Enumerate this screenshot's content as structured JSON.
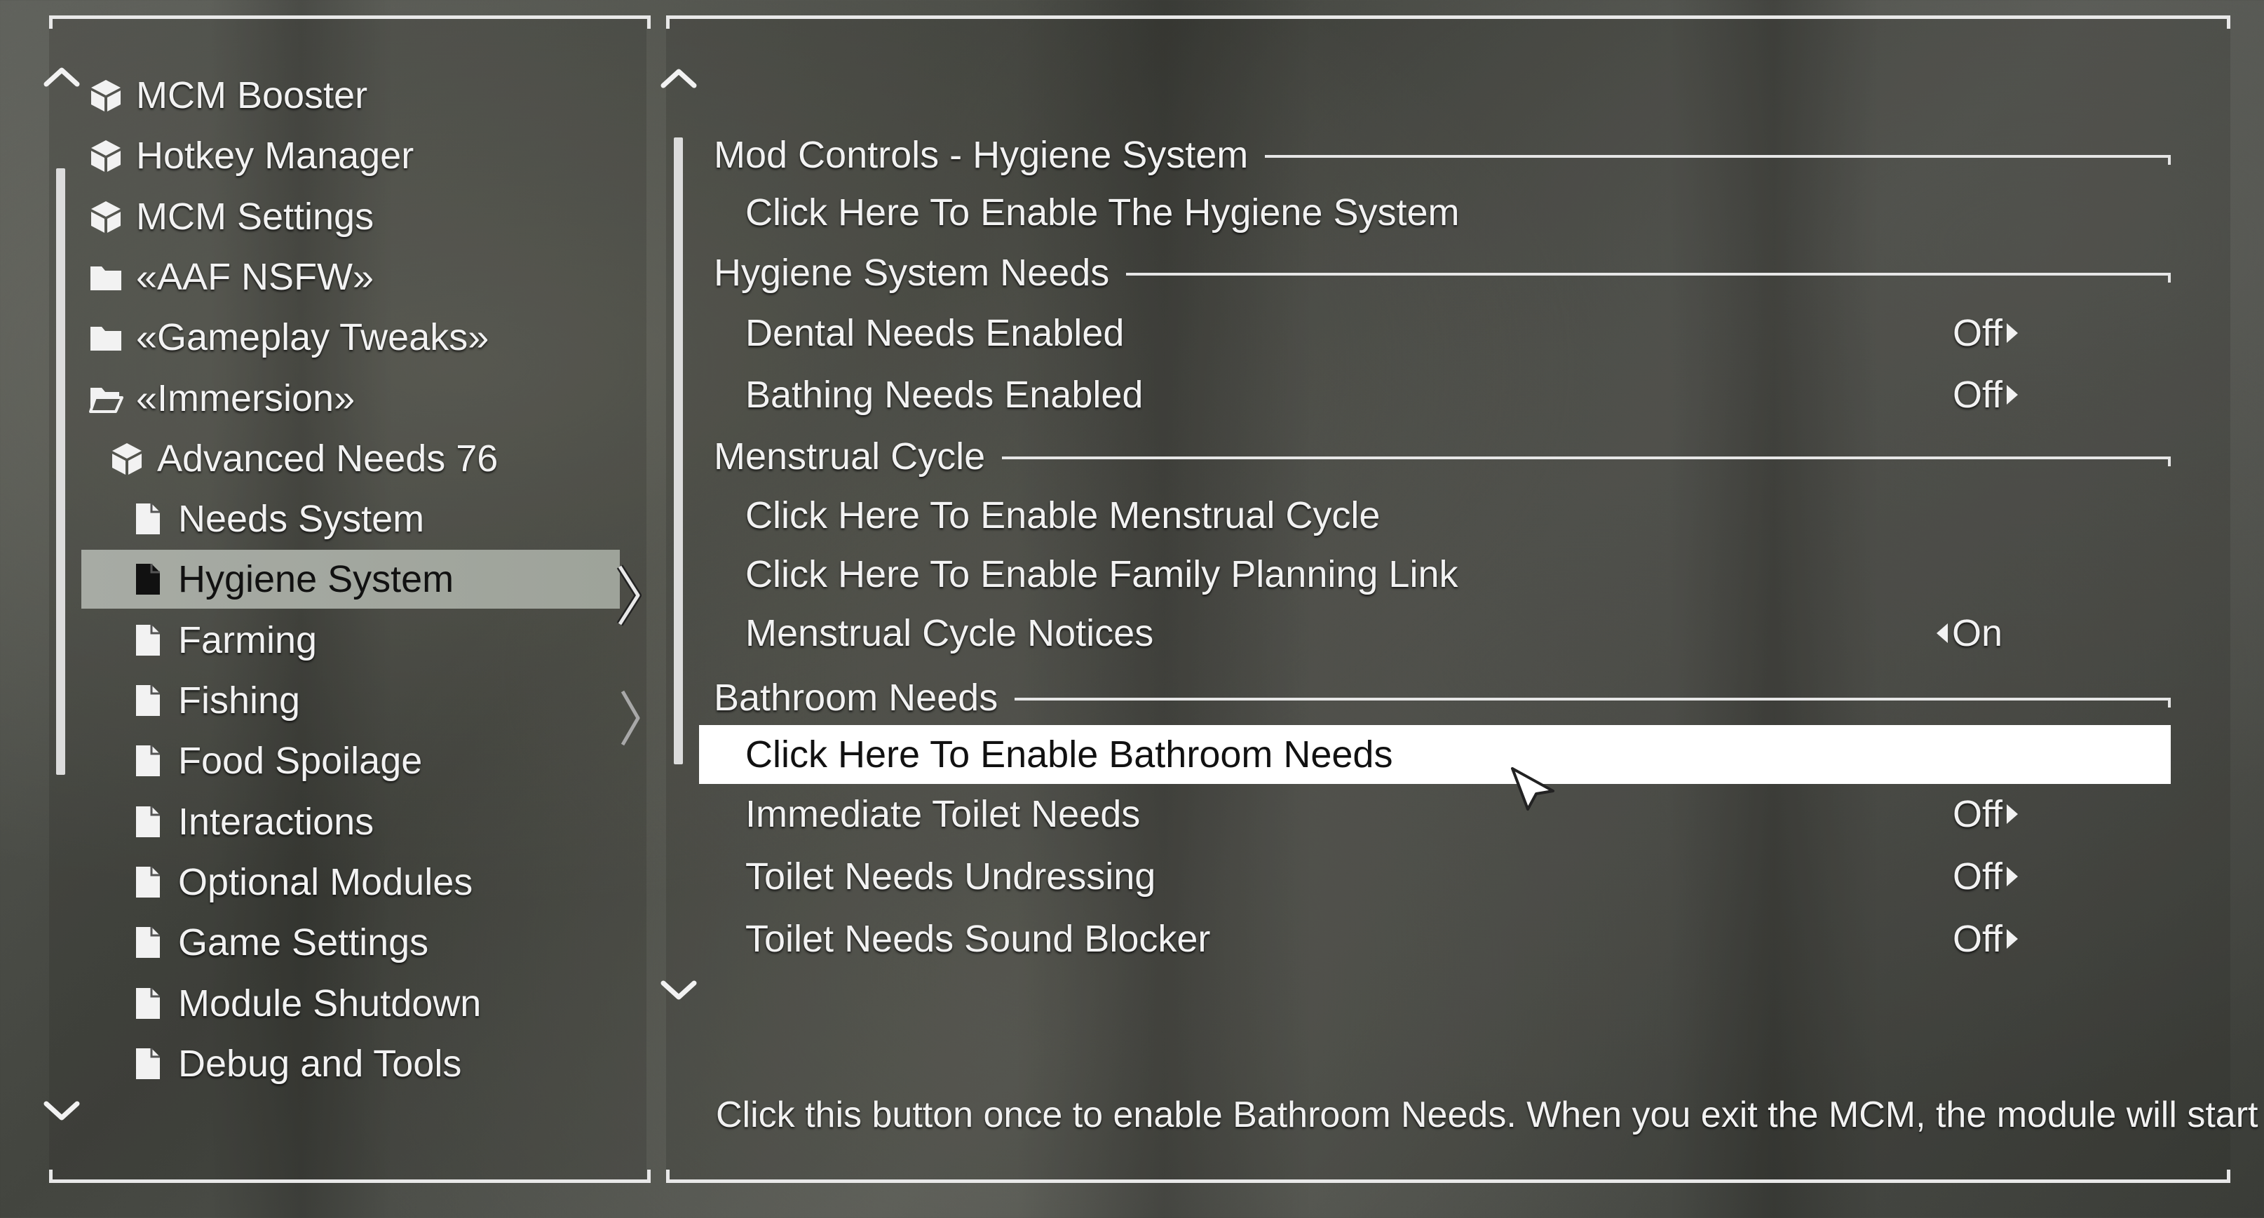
{
  "colors": {
    "frame": "#e8e8e8",
    "selected_bg": "#a7aba4",
    "highlight_bg": "#ffffff",
    "text": "#f2f2f2"
  },
  "left_nav": {
    "scroll_up_icon": "chevron-up-icon",
    "scroll_down_icon": "chevron-down-icon",
    "items": [
      {
        "label": "MCM Booster",
        "icon": "cube-icon",
        "level": 0
      },
      {
        "label": "Hotkey Manager",
        "icon": "cube-icon",
        "level": 0
      },
      {
        "label": "MCM Settings",
        "icon": "cube-icon",
        "level": 0
      },
      {
        "label": "«AAF NSFW»",
        "icon": "folder-icon",
        "level": 0
      },
      {
        "label": "«Gameplay Tweaks»",
        "icon": "folder-icon",
        "level": 0
      },
      {
        "label": "«Immersion»",
        "icon": "folder-open-icon",
        "level": 0
      },
      {
        "label": "Advanced Needs 76",
        "icon": "cube-icon",
        "level": 1
      },
      {
        "label": "Needs System",
        "icon": "page-icon",
        "level": 2
      },
      {
        "label": "Hygiene System",
        "icon": "page-icon",
        "level": 2,
        "selected": true
      },
      {
        "label": "Farming",
        "icon": "page-icon",
        "level": 2
      },
      {
        "label": "Fishing",
        "icon": "page-icon",
        "level": 2
      },
      {
        "label": "Food Spoilage",
        "icon": "page-icon",
        "level": 2
      },
      {
        "label": "Interactions",
        "icon": "page-icon",
        "level": 2
      },
      {
        "label": "Optional Modules",
        "icon": "page-icon",
        "level": 2
      },
      {
        "label": "Game Settings",
        "icon": "page-icon",
        "level": 2
      },
      {
        "label": "Module Shutdown",
        "icon": "page-icon",
        "level": 2
      },
      {
        "label": "Debug and Tools",
        "icon": "page-icon",
        "level": 2
      }
    ]
  },
  "settings": {
    "sections": [
      {
        "title": "Mod Controls - Hygiene System",
        "options": [
          {
            "label": "Click Here To Enable The Hygiene System",
            "value": "",
            "type": "button"
          }
        ]
      },
      {
        "title": "Hygiene System Needs",
        "options": [
          {
            "label": "Dental Needs Enabled",
            "value": "Off",
            "type": "toggle"
          },
          {
            "label": "Bathing Needs Enabled",
            "value": "Off",
            "type": "toggle"
          }
        ]
      },
      {
        "title": "Menstrual Cycle",
        "options": [
          {
            "label": "Click Here To Enable Menstrual Cycle",
            "value": "",
            "type": "button"
          },
          {
            "label": "Click Here To Enable Family Planning Link",
            "value": "",
            "type": "button"
          },
          {
            "label": "Menstrual Cycle Notices",
            "value": "On",
            "type": "toggle"
          }
        ]
      },
      {
        "title": "Bathroom Needs",
        "options": [
          {
            "label": "Click Here To Enable Bathroom Needs",
            "value": "",
            "type": "button",
            "highlighted": true
          },
          {
            "label": "Immediate Toilet Needs",
            "value": "Off",
            "type": "toggle"
          },
          {
            "label": "Toilet Needs Undressing",
            "value": "Off",
            "type": "toggle"
          },
          {
            "label": "Toilet Needs Sound Blocker",
            "value": "Off",
            "type": "toggle"
          }
        ]
      }
    ],
    "description": "Click this button once to enable Bathroom Needs. When you exit the MCM, the module will start up."
  }
}
